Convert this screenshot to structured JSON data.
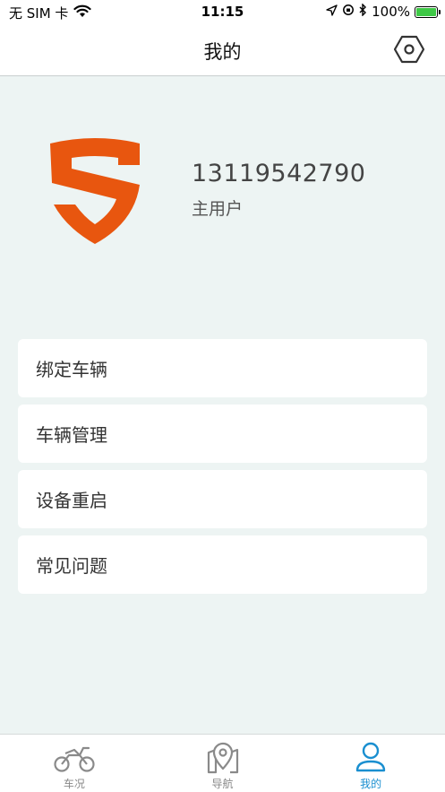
{
  "status_bar": {
    "carrier": "无 SIM 卡",
    "time": "11:15",
    "battery": "100%",
    "battery_level": 1.0
  },
  "header": {
    "title": "我的",
    "settings_icon": "hexagon-gear-icon"
  },
  "profile": {
    "logo_icon": "shield-logo-icon",
    "phone": "13119542790",
    "role": "主用户"
  },
  "menu": {
    "items": [
      {
        "label": "绑定车辆"
      },
      {
        "label": "车辆管理"
      },
      {
        "label": "设备重启"
      },
      {
        "label": "常见问题"
      }
    ]
  },
  "tab_bar": {
    "tabs": [
      {
        "label": "车况",
        "icon": "motorcycle-icon",
        "active": false
      },
      {
        "label": "导航",
        "icon": "map-pin-icon",
        "active": false
      },
      {
        "label": "我的",
        "icon": "user-icon",
        "active": true
      }
    ]
  },
  "colors": {
    "accent": "#1a8fd0",
    "logo": "#e8560f",
    "background": "#edf4f3"
  }
}
